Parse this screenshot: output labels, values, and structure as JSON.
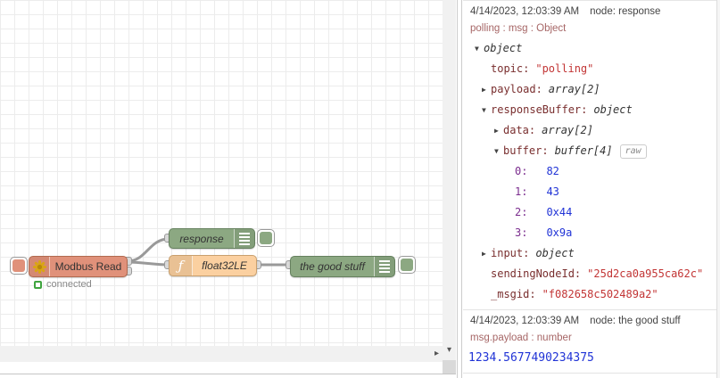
{
  "flow": {
    "nodes": {
      "modbus": {
        "label": "Modbus Read",
        "status": "connected"
      },
      "response": {
        "label": "response"
      },
      "float32": {
        "label": "float32LE",
        "icon": "ƒ"
      },
      "goodstuff": {
        "label": "the good stuff"
      }
    },
    "colors": {
      "modbus_fill": "#e0917a",
      "debug_fill": "#8ca882",
      "function_fill": "#fbd0a0",
      "wire": "#999999",
      "status_green": "#3fa43f"
    }
  },
  "debug": {
    "messages": [
      {
        "timestamp": "4/14/2023, 12:03:39 AM",
        "source": "node: response",
        "path": "polling : msg : Object",
        "tree": [
          {
            "arrow": "▼",
            "type": "object"
          },
          {
            "key": "topic:",
            "str": "\"polling\""
          },
          {
            "arrow": "▶",
            "key": "payload:",
            "type": "array[2]"
          },
          {
            "arrow": "▼",
            "key": "responseBuffer:",
            "type": "object"
          },
          {
            "arrow": "▶",
            "key": "data:",
            "type": "array[2]"
          },
          {
            "arrow": "▼",
            "key": "buffer:",
            "type": "buffer[4]",
            "raw": "raw"
          },
          {
            "key": "0:",
            "num": "82"
          },
          {
            "key": "1:",
            "num": "43"
          },
          {
            "key": "2:",
            "num": "0x44"
          },
          {
            "key": "3:",
            "num": "0x9a"
          },
          {
            "arrow": "▶",
            "key": "input:",
            "type": "object"
          },
          {
            "key": "sendingNodeId:",
            "str": "\"25d2ca0a955ca62c\""
          },
          {
            "key": "_msgid:",
            "str": "\"f082658c502489a2\""
          }
        ]
      },
      {
        "timestamp": "4/14/2023, 12:03:39 AM",
        "source": "node: the good stuff",
        "path": "msg.payload : number",
        "value": "1234.5677490234375"
      }
    ]
  },
  "chrome": {
    "scroll_down_arrow": "▾",
    "scroll_right_arrow": "▸"
  }
}
